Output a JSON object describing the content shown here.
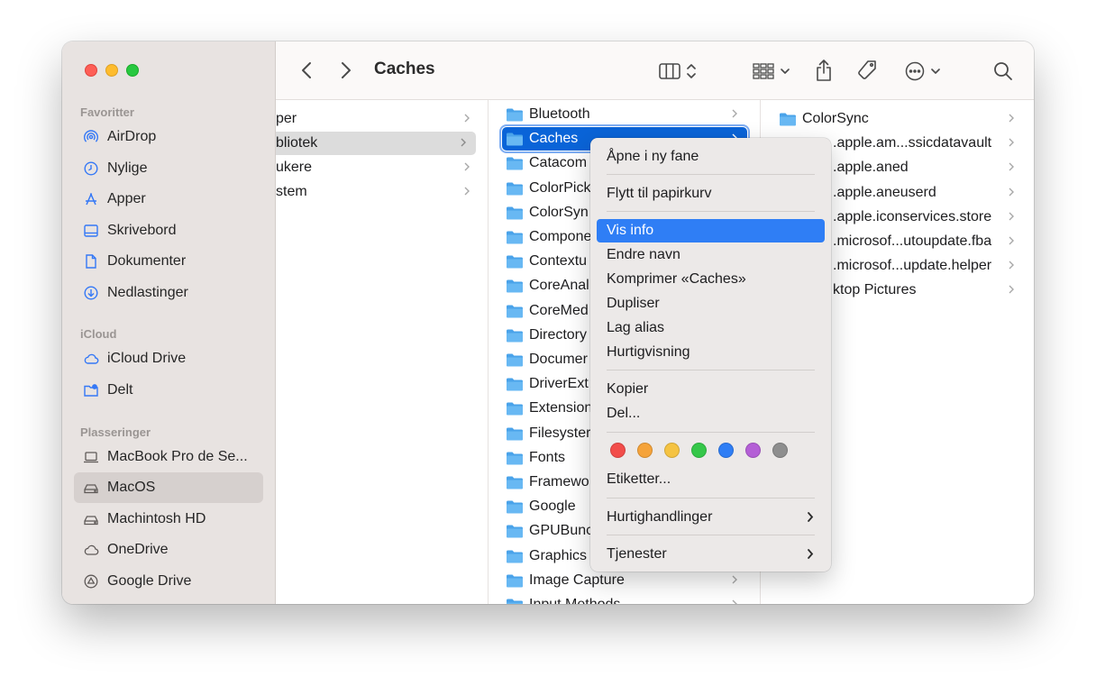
{
  "window": {
    "title": "Caches"
  },
  "sidebar": {
    "sections": [
      {
        "label": "Favoritter",
        "items": [
          {
            "label": "AirDrop",
            "icon": "airdrop-icon"
          },
          {
            "label": "Nylige",
            "icon": "clock-icon"
          },
          {
            "label": "Apper",
            "icon": "apps-icon"
          },
          {
            "label": "Skrivebord",
            "icon": "desktop-icon"
          },
          {
            "label": "Dokumenter",
            "icon": "document-icon"
          },
          {
            "label": "Nedlastinger",
            "icon": "download-icon"
          }
        ]
      },
      {
        "label": "iCloud",
        "items": [
          {
            "label": "iCloud Drive",
            "icon": "cloud-icon"
          },
          {
            "label": "Delt",
            "icon": "shared-folder-icon"
          }
        ]
      },
      {
        "label": "Plasseringer",
        "items": [
          {
            "label": "MacBook Pro de Se...",
            "icon": "laptop-icon"
          },
          {
            "label": "MacOS",
            "icon": "disk-icon",
            "selected": true
          },
          {
            "label": "Machintosh HD",
            "icon": "disk-icon"
          },
          {
            "label": "OneDrive",
            "icon": "cloud-icon"
          },
          {
            "label": "Google Drive",
            "icon": "google-drive-icon"
          }
        ]
      }
    ]
  },
  "columns": {
    "col1": [
      "per",
      "bliotek",
      "ukere",
      "stem"
    ],
    "col2": [
      "Bluetooth",
      "Caches",
      "Catacom",
      "ColorPick",
      "ColorSyn",
      "Compone",
      "Contextu",
      "CoreAnal",
      "CoreMed",
      "Directory",
      "Documer",
      "DriverExt",
      "Extension",
      "Filesyster",
      "Fonts",
      "Framewo",
      "Google",
      "GPUBunc",
      "Graphics",
      "Image Capture",
      "Input Methods"
    ],
    "col3": [
      "ColorSync",
      ".apple.am...ssicdatavault",
      ".apple.aned",
      ".apple.aneuserd",
      ".apple.iconservices.store",
      ".microsof...utoupdate.fba",
      ".microsof...update.helper",
      "ktop Pictures"
    ]
  },
  "context_menu": {
    "items": [
      "Åpne i ny fane",
      "Flytt til papirkurv",
      "Vis info",
      "Endre navn",
      "Komprimer «Caches»",
      "Dupliser",
      "Lag alias",
      "Hurtigvisning",
      "Kopier",
      "Del...",
      "Etiketter...",
      "Hurtighandlinger",
      "Tjenester"
    ],
    "highlighted": "Vis info",
    "tag_colors": [
      "#f24d4a",
      "#f5a33a",
      "#f5c342",
      "#35c749",
      "#2f7ef5",
      "#b45fd6",
      "#8e8e8e"
    ]
  },
  "colors": {
    "accent": "#2f7ef5",
    "folder": "#5fb0f0",
    "selection_blue": "#0a64d8"
  }
}
